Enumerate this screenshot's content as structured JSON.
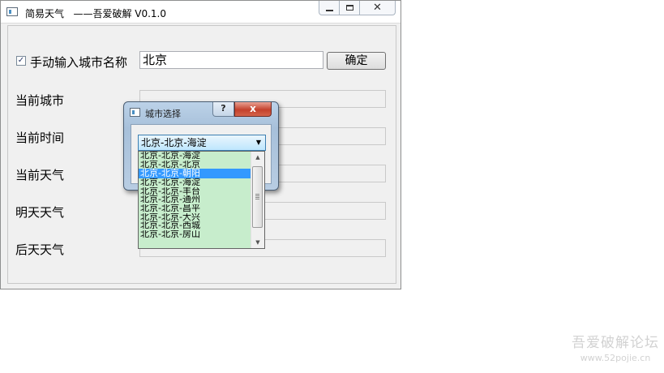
{
  "window": {
    "title": "简易天气   ——吾爱破解 V0.1.0",
    "close_symbol": "✕"
  },
  "form": {
    "manual_checkbox_checked": true,
    "manual_checkbox_mark": "✓",
    "manual_label": "手动输入城市名称",
    "city_input_value": "北京",
    "confirm_label": "确定",
    "rows": [
      {
        "label": "当前城市",
        "value": ""
      },
      {
        "label": "当前时间",
        "value": ""
      },
      {
        "label": "当前天气",
        "value": ""
      },
      {
        "label": "明天天气",
        "value": ""
      },
      {
        "label": "后天天气",
        "value": ""
      }
    ]
  },
  "dialog": {
    "title": "城市选择",
    "help_label": "?",
    "close_label": "x",
    "selected_value": "北京-北京-海淀",
    "arrow": "▼",
    "options": [
      "北京-北京-海淀",
      "北京-北京-北京",
      "北京-北京-朝阳",
      "北京-北京-海淀",
      "北京-北京-丰台",
      "北京-北京-通州",
      "北京-北京-昌平",
      "北京-北京-大兴",
      "北京-北京-西城",
      "北京-北京-房山"
    ],
    "highlighted_index": 2,
    "scroll_up": "▲",
    "scroll_down": "▼"
  },
  "watermark": {
    "line1": "吾爱破解论坛",
    "line2": "www.52pojie.cn"
  },
  "colors": {
    "window_bg": "#f0f0f0",
    "list_bg": "#c7edcc",
    "selection": "#3399ff"
  }
}
